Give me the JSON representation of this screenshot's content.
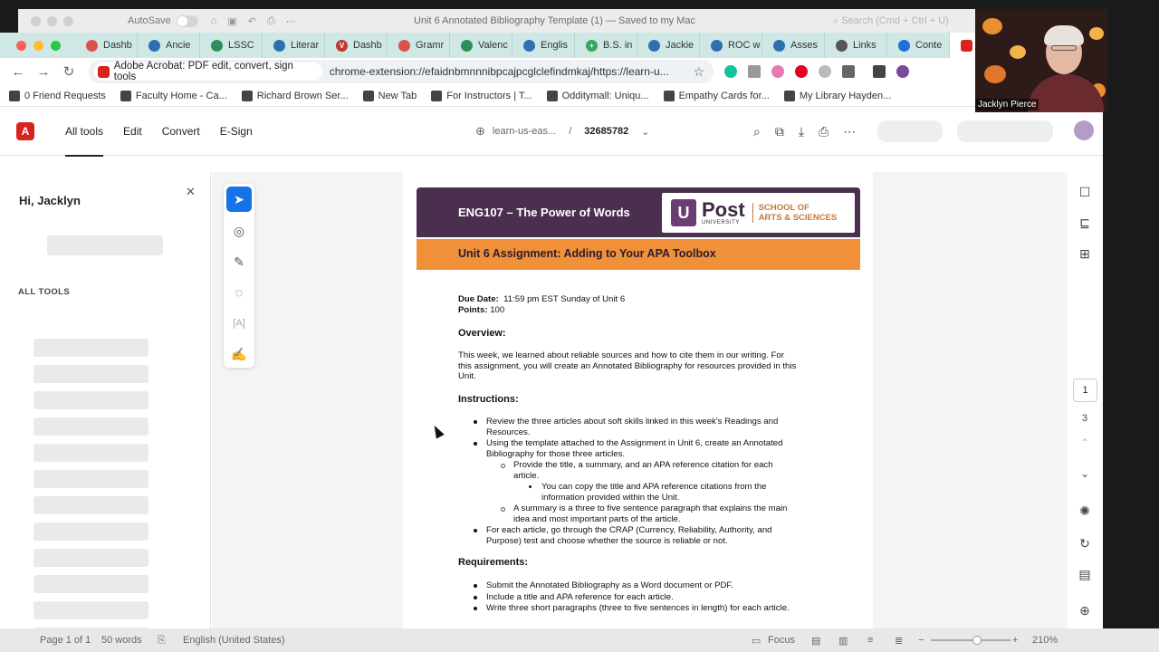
{
  "word": {
    "autosave_label": "AutoSave",
    "doc_title": "Unit 6 Annotated Bibliography Template (1) — Saved to my Mac",
    "search_placeholder": "Search (Cmd + Ctrl + U)"
  },
  "browser": {
    "tabs": [
      {
        "label": "Dashb",
        "color": "#d9534f",
        "glyph": ""
      },
      {
        "label": "Ancie",
        "color": "#2f6fb0",
        "glyph": ""
      },
      {
        "label": "LSSC",
        "color": "#2f8f5b",
        "glyph": ""
      },
      {
        "label": "Literar",
        "color": "#2f6fb0",
        "glyph": ""
      },
      {
        "label": "Dashb",
        "color": "#c0392b",
        "glyph": "V"
      },
      {
        "label": "Gramr",
        "color": "#d9534f",
        "glyph": ""
      },
      {
        "label": "Valenc",
        "color": "#2f8f5b",
        "glyph": ""
      },
      {
        "label": "Englis",
        "color": "#2f6fb0",
        "glyph": ""
      },
      {
        "label": "B.S. in",
        "color": "#3aa55d",
        "glyph": "+"
      },
      {
        "label": "Jackie",
        "color": "#2f6fb0",
        "glyph": ""
      },
      {
        "label": "ROC w",
        "color": "#2f6fb0",
        "glyph": ""
      },
      {
        "label": "Asses",
        "color": "#2f6fb0",
        "glyph": ""
      },
      {
        "label": "Links",
        "color": "#555555",
        "glyph": ""
      },
      {
        "label": "Conte",
        "color": "#1e6fd9",
        "glyph": ""
      }
    ],
    "omnibox_chip": "Adobe Acrobat: PDF edit, convert, sign tools",
    "url": "chrome-extension://efaidnbmnnnibpcajpcglclefindmkaj/https://learn-u...",
    "bookmarks": [
      "0 Friend Requests",
      "Faculty Home - Ca...",
      "Richard Brown Ser...",
      "New Tab",
      "For Instructors | T...",
      "Odditymall: Uniqu...",
      "Empathy Cards for...",
      "My Library Hayden..."
    ]
  },
  "acrobat": {
    "tabs": [
      "All tools",
      "Edit",
      "Convert",
      "E-Sign"
    ],
    "domain": "learn-us-eas...",
    "separator": "/",
    "doc_number": "32685782",
    "greeting": "Hi, Jacklyn",
    "all_tools_heading": "ALL TOOLS",
    "page_current": "1",
    "page_total": "3"
  },
  "document": {
    "course_title": "ENG107 – The Power of Words",
    "logo": {
      "u": "U",
      "post": "Post",
      "university": "UNIVERSITY",
      "school_line1": "SCHOOL OF",
      "school_line2": "ARTS & SCIENCES"
    },
    "assignment_title": "Unit 6 Assignment: Adding to Your APA Toolbox",
    "due_label": "Due Date:",
    "due_value": "11:59 pm EST Sunday of Unit 6",
    "points_label": "Points:",
    "points_value": "100",
    "overview_heading": "Overview:",
    "overview_lines": [
      "This week, we learned about reliable sources and how to cite them in our writing. For",
      "this assignment, you will create an Annotated Bibliography for resources provided in this",
      "Unit."
    ],
    "instructions_heading": "Instructions:",
    "instructions": [
      {
        "level": 1,
        "lines": [
          "Review the three articles about soft skills linked in this week's Readings and",
          "Resources."
        ]
      },
      {
        "level": 1,
        "lines": [
          "Using the template attached to the Assignment in Unit 6, create an Annotated",
          "Bibliography for those three articles."
        ]
      },
      {
        "level": 2,
        "lines": [
          "Provide the title, a summary, and an APA reference citation for each",
          "article."
        ]
      },
      {
        "level": 3,
        "lines": [
          "You can copy the title and APA reference citations from the",
          "information provided within the Unit."
        ]
      },
      {
        "level": 2,
        "lines": [
          "A summary is a three to five sentence paragraph that explains the main",
          "idea and most important parts of the article."
        ]
      },
      {
        "level": 1,
        "lines": [
          "For each article, go through the CRAP (Currency, Reliability, Authority, and",
          "Purpose) test and choose whether the source is reliable or not."
        ]
      }
    ],
    "requirements_heading": "Requirements:",
    "requirements": [
      "Submit the Annotated Bibliography as a Word document or PDF.",
      "Include a title and APA reference for each article.",
      "Write three short paragraphs (three to five sentences in length) for each article."
    ]
  },
  "word_status": {
    "page": "Page 1 of 1",
    "words": "50 words",
    "language": "English (United States)",
    "focus": "Focus",
    "zoom": "210%"
  },
  "webcam": {
    "name": "Jacklyn Pierce"
  },
  "colors": {
    "banner_purple": "#4a2f4f",
    "banner_orange": "#f0913a",
    "acrobat_red": "#d9231e",
    "select_blue": "#1473e6"
  }
}
